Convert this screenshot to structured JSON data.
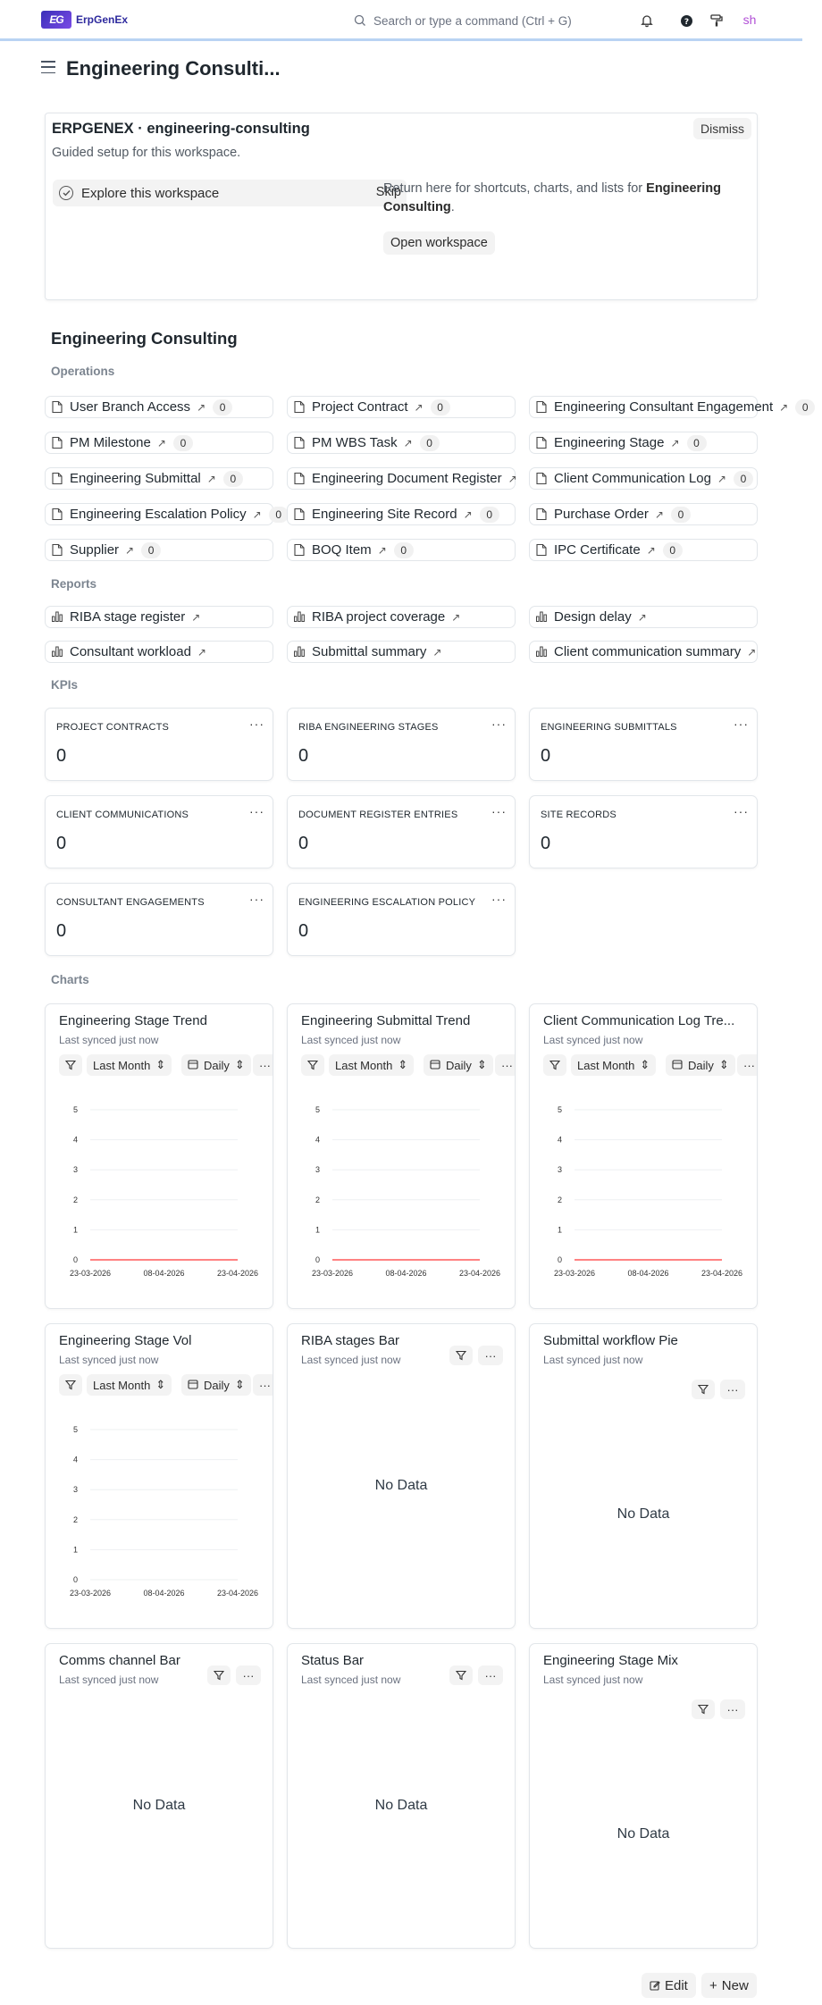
{
  "navbar": {
    "logo_mark": "EG",
    "logo_text": "ErpGenEx",
    "search_placeholder": "Search or type a command (Ctrl + G)",
    "avatar_initials": "sh",
    "icons": [
      "bell-icon",
      "help-icon",
      "paint-roller-icon"
    ]
  },
  "page": {
    "title": "Engineering Consulti..."
  },
  "onboarding": {
    "title": "ERPGENEX · engineering-consulting",
    "subtitle": "Guided setup for this workspace.",
    "dismiss_label": "Dismiss",
    "step_label": "Explore this workspace",
    "skip_label": "Skip",
    "right_text_prefix": "Return here for shortcuts, charts, and lists for ",
    "right_text_bold": "Engineering Consulting",
    "right_text_suffix": ".",
    "open_button": "Open workspace"
  },
  "workspace": {
    "title": "Engineering Consulting",
    "operations_label": "Operations",
    "reports_label": "Reports",
    "kpis_label": "KPIs",
    "charts_label": "Charts"
  },
  "operations": [
    {
      "label": "User Branch Access",
      "count": "0"
    },
    {
      "label": "Project Contract",
      "count": "0"
    },
    {
      "label": "Engineering Consultant Engagement",
      "count": "0"
    },
    {
      "label": "PM Milestone",
      "count": "0"
    },
    {
      "label": "PM WBS Task",
      "count": "0"
    },
    {
      "label": "Engineering Stage",
      "count": "0"
    },
    {
      "label": "Engineering Submittal",
      "count": "0"
    },
    {
      "label": "Engineering Document Register",
      "count": ""
    },
    {
      "label": "Client Communication Log",
      "count": "0"
    },
    {
      "label": "Engineering Escalation Policy",
      "count": "0"
    },
    {
      "label": "Engineering Site Record",
      "count": "0"
    },
    {
      "label": "Purchase Order",
      "count": "0"
    },
    {
      "label": "Supplier",
      "count": "0"
    },
    {
      "label": "BOQ Item",
      "count": "0"
    },
    {
      "label": "IPC Certificate",
      "count": "0"
    }
  ],
  "reports": [
    {
      "label": "RIBA stage register"
    },
    {
      "label": "RIBA project coverage"
    },
    {
      "label": "Design delay"
    },
    {
      "label": "Consultant workload"
    },
    {
      "label": "Submittal summary"
    },
    {
      "label": "Client communication summary"
    }
  ],
  "kpis": [
    {
      "label": "PROJECT CONTRACTS",
      "value": "0"
    },
    {
      "label": "RIBA ENGINEERING STAGES",
      "value": "0"
    },
    {
      "label": "ENGINEERING SUBMITTALS",
      "value": "0"
    },
    {
      "label": "CLIENT COMMUNICATIONS",
      "value": "0"
    },
    {
      "label": "DOCUMENT REGISTER ENTRIES",
      "value": "0"
    },
    {
      "label": "SITE RECORDS",
      "value": "0"
    },
    {
      "label": "CONSULTANT ENGAGEMENTS",
      "value": "0"
    },
    {
      "label": "ENGINEERING ESCALATION POLICY",
      "value": "0"
    }
  ],
  "charts_common": {
    "synced": "Last synced just now",
    "period": "Last Month",
    "interval": "Daily",
    "no_data": "No Data",
    "menu": "···"
  },
  "charts": [
    {
      "title": "Engineering Stage Trend",
      "kind": "line"
    },
    {
      "title": "Engineering Submittal Trend",
      "kind": "line"
    },
    {
      "title": "Client Communication Log Tre...",
      "kind": "line"
    },
    {
      "title": "Engineering Stage Vol",
      "kind": "line"
    },
    {
      "title": "RIBA stages Bar",
      "kind": "empty"
    },
    {
      "title": "Submittal workflow Pie",
      "kind": "empty"
    },
    {
      "title": "Comms channel Bar",
      "kind": "empty"
    },
    {
      "title": "Status Bar",
      "kind": "empty"
    },
    {
      "title": "Engineering Stage Mix",
      "kind": "empty"
    }
  ],
  "chart_data": [
    {
      "type": "line",
      "title": "Engineering Stage Trend",
      "x": [
        "23-03-2026",
        "08-04-2026",
        "23-04-2026"
      ],
      "y": [
        0,
        0,
        0
      ],
      "yticks": [
        0,
        1,
        2,
        3,
        4,
        5
      ],
      "ylim": [
        0,
        5
      ],
      "series_color": "#ff5858"
    },
    {
      "type": "line",
      "title": "Engineering Submittal Trend",
      "x": [
        "23-03-2026",
        "08-04-2026",
        "23-04-2026"
      ],
      "y": [
        0,
        0,
        0
      ],
      "yticks": [
        0,
        1,
        2,
        3,
        4,
        5
      ],
      "ylim": [
        0,
        5
      ],
      "series_color": "#ff5858"
    },
    {
      "type": "line",
      "title": "Client Communication Log Tre...",
      "x": [
        "23-03-2026",
        "08-04-2026",
        "23-04-2026"
      ],
      "y": [
        0,
        0,
        0
      ],
      "yticks": [
        0,
        1,
        2,
        3,
        4,
        5
      ],
      "ylim": [
        0,
        5
      ],
      "series_color": "#ff5858"
    },
    {
      "type": "line",
      "title": "Engineering Stage Vol",
      "x": [
        "23-03-2026",
        "08-04-2026",
        "23-04-2026"
      ],
      "y": [],
      "yticks": [
        0,
        1,
        2,
        3,
        4,
        5
      ],
      "ylim": [
        0,
        5
      ],
      "series_color": "#ff5858"
    }
  ],
  "footer": {
    "edit_label": "Edit",
    "new_label": "New"
  }
}
